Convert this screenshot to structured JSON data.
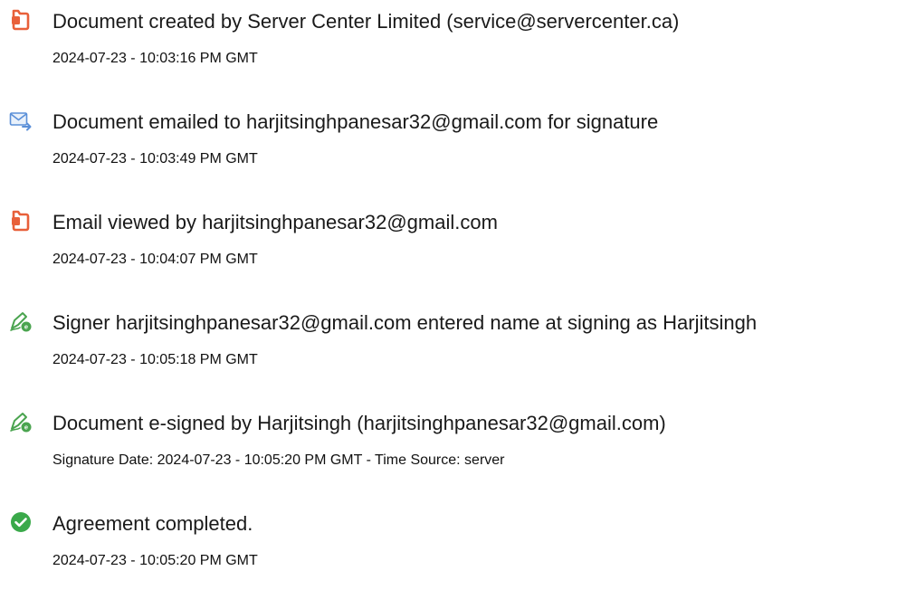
{
  "colors": {
    "document_icon": "#e8603a",
    "email_icon": "#5a8fd8",
    "signature_icon": "#4aa44f",
    "completed_icon": "#3aa94a"
  },
  "events": [
    {
      "icon": "document-icon",
      "title": "Document created by Server Center Limited (service@servercenter.ca)",
      "subtitle": "2024-07-23 - 10:03:16 PM GMT"
    },
    {
      "icon": "email-sent-icon",
      "title": "Document emailed to harjitsinghpanesar32@gmail.com for signature",
      "subtitle": "2024-07-23 - 10:03:49 PM GMT"
    },
    {
      "icon": "document-icon",
      "title": "Email viewed by harjitsinghpanesar32@gmail.com",
      "subtitle": "2024-07-23 - 10:04:07 PM GMT"
    },
    {
      "icon": "e-signature-icon",
      "title": "Signer harjitsinghpanesar32@gmail.com entered name at signing as Harjitsingh",
      "subtitle": "2024-07-23 - 10:05:18 PM GMT"
    },
    {
      "icon": "e-signature-icon",
      "title": "Document e-signed by Harjitsingh (harjitsinghpanesar32@gmail.com)",
      "subtitle": "Signature Date: 2024-07-23 - 10:05:20 PM GMT - Time Source: server"
    },
    {
      "icon": "checkmark-circle-icon",
      "title": "Agreement completed.",
      "subtitle": "2024-07-23 - 10:05:20 PM GMT"
    }
  ]
}
